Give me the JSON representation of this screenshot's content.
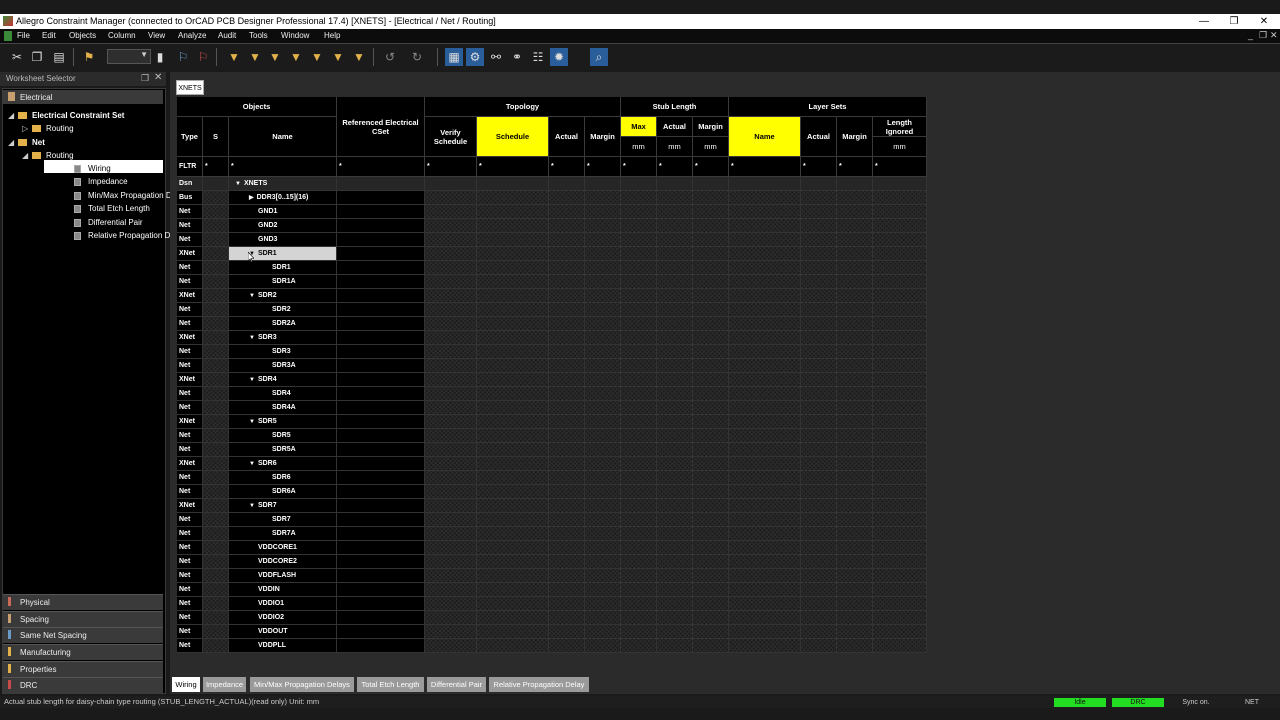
{
  "window": {
    "title": "Allegro Constraint Manager (connected to OrCAD PCB Designer Professional 17.4) [XNETS] - [Electrical / Net / Routing]",
    "minimize": "—",
    "restore": "❐",
    "close": "✕"
  },
  "menu": [
    "File",
    "Edit",
    "Objects",
    "Column",
    "View",
    "Analyze",
    "Audit",
    "Tools",
    "Window",
    "Help"
  ],
  "mdi_controls": {
    "minimize": "_",
    "restore": "❐",
    "close": "✕"
  },
  "worksheet_selector": {
    "title": "Worksheet Selector",
    "pin": "❐",
    "close": "✕",
    "top_category": "Electrical",
    "tree": [
      {
        "level": 0,
        "kind": "folder",
        "expander": "◢",
        "label": "Electrical Constraint Set",
        "bold": true
      },
      {
        "level": 1,
        "kind": "folder",
        "expander": "▷",
        "label": "Routing",
        "bold": false
      },
      {
        "level": 0,
        "kind": "folder",
        "expander": "◢",
        "label": "Net",
        "bold": true
      },
      {
        "level": 1,
        "kind": "folder",
        "expander": "◢",
        "label": "Routing",
        "bold": false
      },
      {
        "level": 2,
        "kind": "sheet",
        "expander": "",
        "label": "Wiring",
        "bold": false,
        "selected": true
      },
      {
        "level": 2,
        "kind": "sheet",
        "expander": "",
        "label": "Impedance",
        "bold": false
      },
      {
        "level": 2,
        "kind": "sheet",
        "expander": "",
        "label": "Min/Max Propagation Delays",
        "bold": false
      },
      {
        "level": 2,
        "kind": "sheet",
        "expander": "",
        "label": "Total Etch Length",
        "bold": false
      },
      {
        "level": 2,
        "kind": "sheet",
        "expander": "",
        "label": "Differential Pair",
        "bold": false
      },
      {
        "level": 2,
        "kind": "sheet",
        "expander": "",
        "label": "Relative Propagation Delay",
        "bold": false
      }
    ],
    "bottom_categories": [
      {
        "label": "Physical",
        "color": "#c86a5a"
      },
      {
        "label": "Spacing",
        "color": "#c8a070"
      },
      {
        "label": "Same Net Spacing",
        "color": "#6a9ac8"
      },
      {
        "label": "Manufacturing",
        "color": "#e2b14a"
      },
      {
        "label": "Properties",
        "color": "#e2b14a"
      },
      {
        "label": "DRC",
        "color": "#c84a4a"
      }
    ]
  },
  "worksheet_tab": "XNETS",
  "grid": {
    "group_headers": {
      "objects": "Objects",
      "topology": "Topology",
      "stub_length": "Stub Length",
      "layer_sets": "Layer Sets"
    },
    "columns": {
      "type": "Type",
      "s": "S",
      "name": "Name",
      "ref_cset": "Referenced Electrical CSet",
      "verify_schedule": "Verify Schedule",
      "schedule": "Schedule",
      "topo_actual": "Actual",
      "topo_margin": "Margin",
      "stub_max": "Max",
      "stub_actual": "Actual",
      "stub_margin": "Margin",
      "layer_name": "Name",
      "layer_actual": "Actual",
      "layer_margin": "Margin",
      "length_ignored": "Length Ignored"
    },
    "units": {
      "stub_max": "mm",
      "stub_actual": "mm",
      "stub_margin": "mm",
      "length_ignored": "mm"
    },
    "filter": {
      "label": "FLTR",
      "wildcard": "*"
    },
    "rows": [
      {
        "type": "Dsn",
        "name": "XNETS",
        "indent": 0,
        "expander": "▼"
      },
      {
        "type": "Bus",
        "name": "DDR3[0..15](16)",
        "indent": 1,
        "expander": "▶"
      },
      {
        "type": "Net",
        "name": "GND1",
        "indent": 1,
        "expander": ""
      },
      {
        "type": "Net",
        "name": "GND2",
        "indent": 1,
        "expander": ""
      },
      {
        "type": "Net",
        "name": "GND3",
        "indent": 1,
        "expander": ""
      },
      {
        "type": "XNet",
        "name": "SDR1",
        "indent": 1,
        "expander": "▼",
        "selected": true
      },
      {
        "type": "Net",
        "name": "SDR1",
        "indent": 2,
        "expander": ""
      },
      {
        "type": "Net",
        "name": "SDR1A",
        "indent": 2,
        "expander": ""
      },
      {
        "type": "XNet",
        "name": "SDR2",
        "indent": 1,
        "expander": "▼"
      },
      {
        "type": "Net",
        "name": "SDR2",
        "indent": 2,
        "expander": ""
      },
      {
        "type": "Net",
        "name": "SDR2A",
        "indent": 2,
        "expander": ""
      },
      {
        "type": "XNet",
        "name": "SDR3",
        "indent": 1,
        "expander": "▼"
      },
      {
        "type": "Net",
        "name": "SDR3",
        "indent": 2,
        "expander": ""
      },
      {
        "type": "Net",
        "name": "SDR3A",
        "indent": 2,
        "expander": ""
      },
      {
        "type": "XNet",
        "name": "SDR4",
        "indent": 1,
        "expander": "▼"
      },
      {
        "type": "Net",
        "name": "SDR4",
        "indent": 2,
        "expander": ""
      },
      {
        "type": "Net",
        "name": "SDR4A",
        "indent": 2,
        "expander": ""
      },
      {
        "type": "XNet",
        "name": "SDR5",
        "indent": 1,
        "expander": "▼"
      },
      {
        "type": "Net",
        "name": "SDR5",
        "indent": 2,
        "expander": ""
      },
      {
        "type": "Net",
        "name": "SDR5A",
        "indent": 2,
        "expander": ""
      },
      {
        "type": "XNet",
        "name": "SDR6",
        "indent": 1,
        "expander": "▼"
      },
      {
        "type": "Net",
        "name": "SDR6",
        "indent": 2,
        "expander": ""
      },
      {
        "type": "Net",
        "name": "SDR6A",
        "indent": 2,
        "expander": ""
      },
      {
        "type": "XNet",
        "name": "SDR7",
        "indent": 1,
        "expander": "▼"
      },
      {
        "type": "Net",
        "name": "SDR7",
        "indent": 2,
        "expander": ""
      },
      {
        "type": "Net",
        "name": "SDR7A",
        "indent": 2,
        "expander": ""
      },
      {
        "type": "Net",
        "name": "VDDCORE1",
        "indent": 1,
        "expander": ""
      },
      {
        "type": "Net",
        "name": "VDDCORE2",
        "indent": 1,
        "expander": ""
      },
      {
        "type": "Net",
        "name": "VDDFLASH",
        "indent": 1,
        "expander": ""
      },
      {
        "type": "Net",
        "name": "VDDIN",
        "indent": 1,
        "expander": ""
      },
      {
        "type": "Net",
        "name": "VDDIO1",
        "indent": 1,
        "expander": ""
      },
      {
        "type": "Net",
        "name": "VDDIO2",
        "indent": 1,
        "expander": ""
      },
      {
        "type": "Net",
        "name": "VDDOUT",
        "indent": 1,
        "expander": ""
      },
      {
        "type": "Net",
        "name": "VDDPLL",
        "indent": 1,
        "expander": ""
      }
    ]
  },
  "bottom_tabs": [
    {
      "label": "Wiring",
      "active": true
    },
    {
      "label": "Impedance",
      "active": false
    },
    {
      "label": "Min/Max Propagation Delays",
      "active": false
    },
    {
      "label": "Total Etch Length",
      "active": false
    },
    {
      "label": "Differential Pair",
      "active": false
    },
    {
      "label": "Relative Propagation Delay",
      "active": false
    }
  ],
  "status": {
    "message": "Actual stub length for daisy-chain type routing (STUB_LENGTH_ACTUAL)(read only) Unit: mm",
    "idle": "Idle",
    "drc": "DRC",
    "sync": "Sync on.",
    "scope": "NET"
  },
  "colors": {
    "highlight_yellow": "#ffff00",
    "idle_green": "#22dd22",
    "drc_green": "#22dd22"
  }
}
